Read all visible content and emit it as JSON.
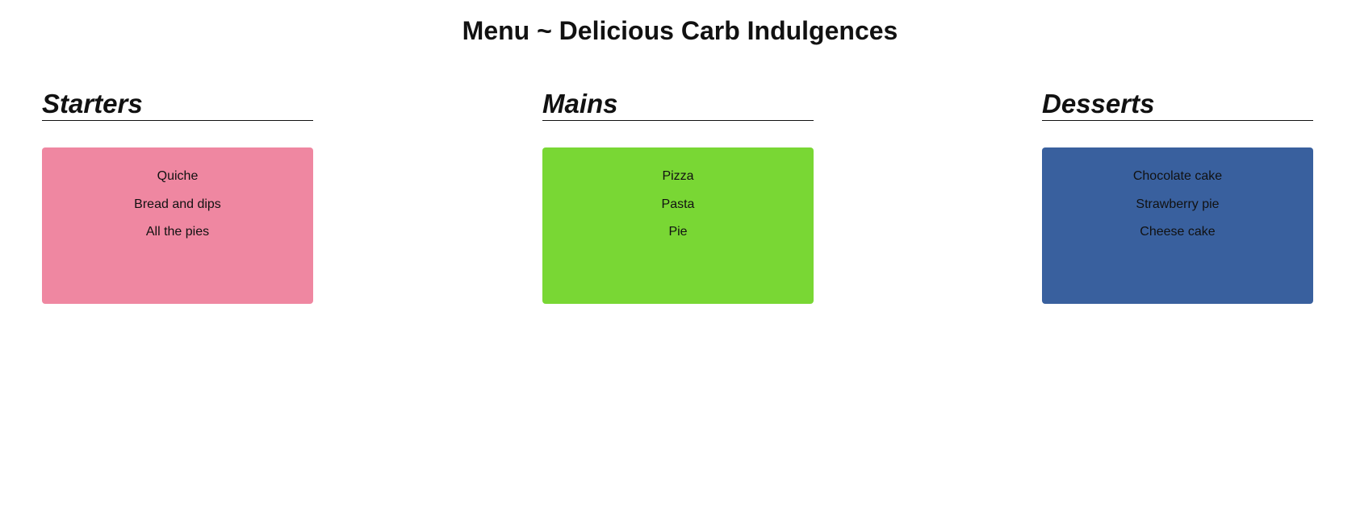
{
  "page": {
    "title": "Menu ~ Delicious Carb Indulgences"
  },
  "sections": [
    {
      "heading": "Starters",
      "color": "#ef87a1",
      "items": [
        "Quiche",
        "Bread and dips",
        "All the pies"
      ]
    },
    {
      "heading": "Mains",
      "color": "#79d734",
      "items": [
        "Pizza",
        "Pasta",
        "Pie"
      ]
    },
    {
      "heading": "Desserts",
      "color": "#39609e",
      "items": [
        "Chocolate cake",
        "Strawberry pie",
        "Cheese cake"
      ]
    }
  ]
}
